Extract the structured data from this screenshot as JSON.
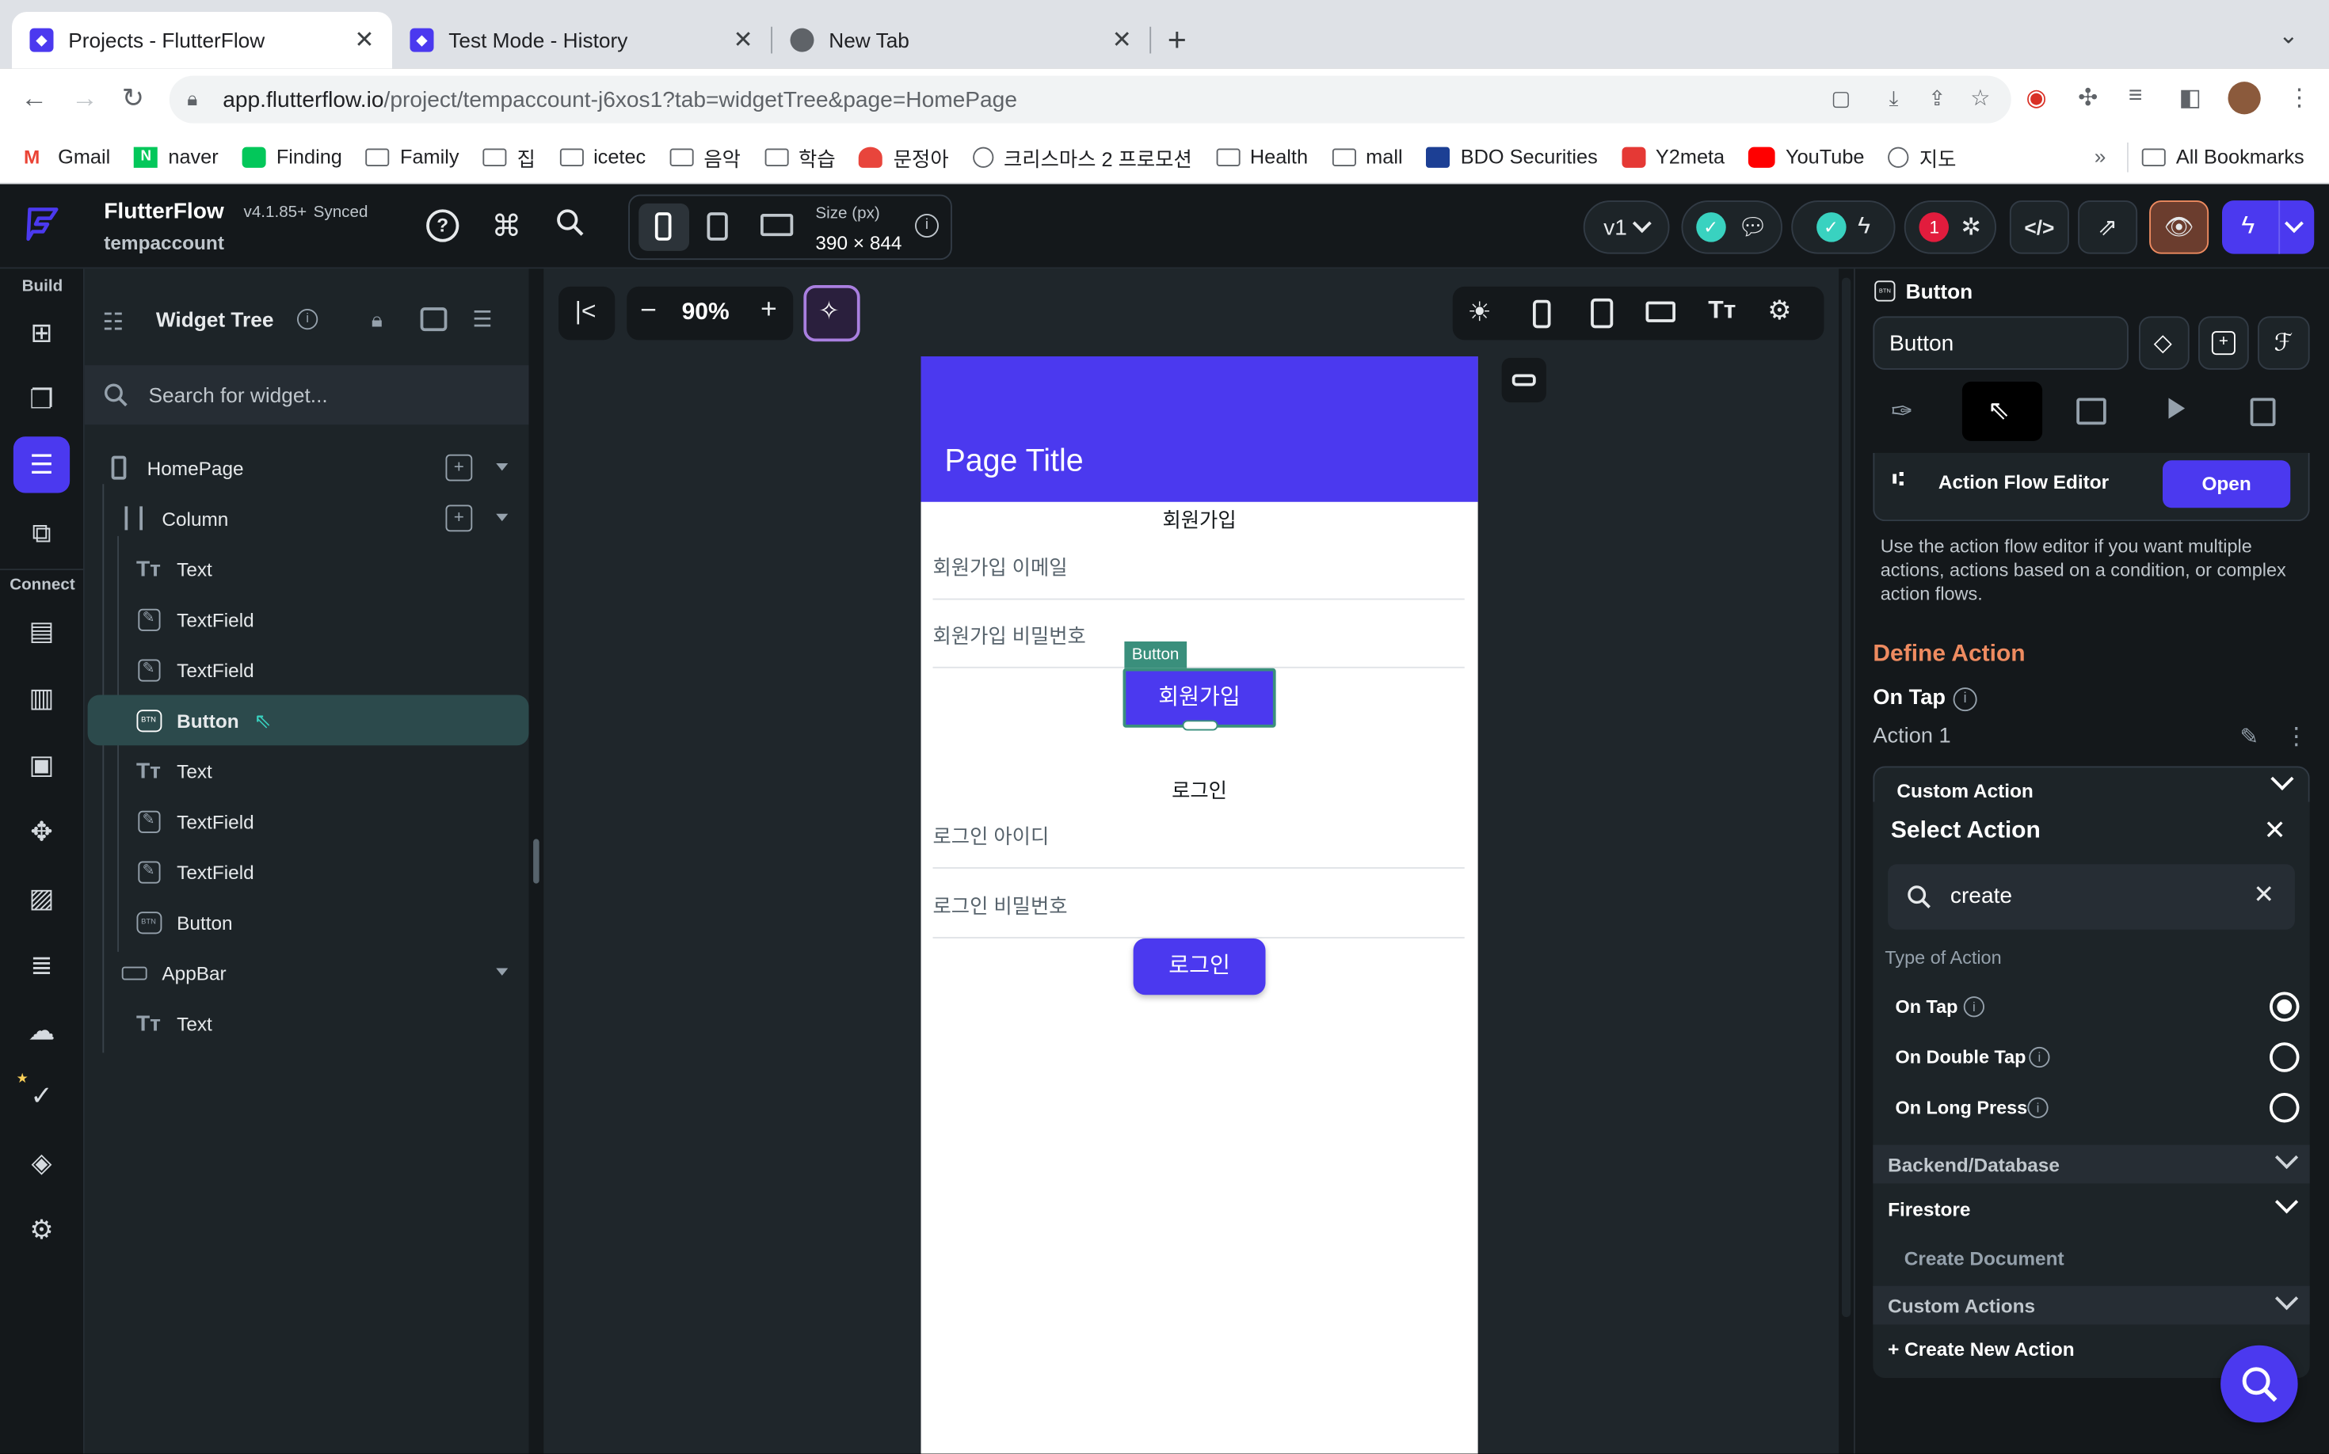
{
  "browser": {
    "tabs": [
      {
        "title": "Projects - FlutterFlow",
        "active": true
      },
      {
        "title": "Test Mode - History",
        "active": false
      },
      {
        "title": "New Tab",
        "active": false
      }
    ],
    "url_host": "app.flutterflow.io",
    "url_path": "/project/tempaccount-j6xos1?tab=widgetTree&page=HomePage",
    "bookmarks": [
      "Gmail",
      "naver",
      "Finding",
      "Family",
      "집",
      "icetec",
      "음악",
      "학습",
      "문정아",
      "크리스마스 2 프로모션",
      "Health",
      "mall",
      "BDO Securities",
      "Y2meta",
      "YouTube",
      "지도"
    ],
    "bookmarks_overflow": "»",
    "all_bookmarks": "All Bookmarks"
  },
  "header": {
    "app_name": "FlutterFlow",
    "version": "v4.1.85+",
    "sync_status": "Synced",
    "project": "tempaccount",
    "size_label": "Size (px)",
    "size_value": "390 × 844",
    "version_select": "v1",
    "error_count": "1"
  },
  "rail": {
    "build_label": "Build",
    "connect_label": "Connect"
  },
  "widget_tree": {
    "title": "Widget Tree",
    "search_placeholder": "Search for widget...",
    "items": [
      {
        "label": "HomePage",
        "icon": "phone-icon"
      },
      {
        "label": "Column",
        "icon": "column-icon"
      },
      {
        "label": "Text",
        "icon": "text-icon"
      },
      {
        "label": "TextField",
        "icon": "textfield-icon"
      },
      {
        "label": "TextField",
        "icon": "textfield-icon"
      },
      {
        "label": "Button",
        "icon": "button-icon"
      },
      {
        "label": "Text",
        "icon": "text-icon"
      },
      {
        "label": "TextField",
        "icon": "textfield-icon"
      },
      {
        "label": "TextField",
        "icon": "textfield-icon"
      },
      {
        "label": "Button",
        "icon": "button-icon"
      },
      {
        "label": "AppBar",
        "icon": "appbar-icon"
      },
      {
        "label": "Text",
        "icon": "text-icon"
      }
    ]
  },
  "canvas": {
    "zoom": "90%",
    "page_title": "Page Title",
    "signup_title": "회원가입",
    "signup_email": "회원가입 이메일",
    "signup_password": "회원가입 비밀번호",
    "selected_tag": "Button",
    "signup_button": "회원가입",
    "login_title": "로그인",
    "login_id": "로그인 아이디",
    "login_password": "로그인 비밀번호",
    "login_button": "로그인"
  },
  "properties": {
    "widget_type": "Button",
    "widget_name": "Button",
    "action_flow_editor": "Action Flow Editor",
    "open_label": "Open",
    "help_text": "Use the action flow editor if you want multiple actions, actions based on a condition, or complex action flows.",
    "define_action": "Define Action",
    "on_tap": "On Tap",
    "action_1": "Action 1",
    "custom_action_header": "Custom Action",
    "select_action": "Select Action",
    "search_value": "create",
    "type_of_action": "Type of Action",
    "types": [
      {
        "label": "On Tap",
        "selected": true
      },
      {
        "label": "On Double Tap",
        "selected": false
      },
      {
        "label": "On Long Press",
        "selected": false
      }
    ],
    "section_backend": "Backend/Database",
    "section_firestore": "Firestore",
    "create_document": "Create Document",
    "section_custom_actions": "Custom Actions",
    "create_new_action": "+ Create New Action"
  },
  "colors": {
    "primary": "#4B39EF",
    "accent_orange": "#EE8B60",
    "teal": "#39D2C0"
  }
}
